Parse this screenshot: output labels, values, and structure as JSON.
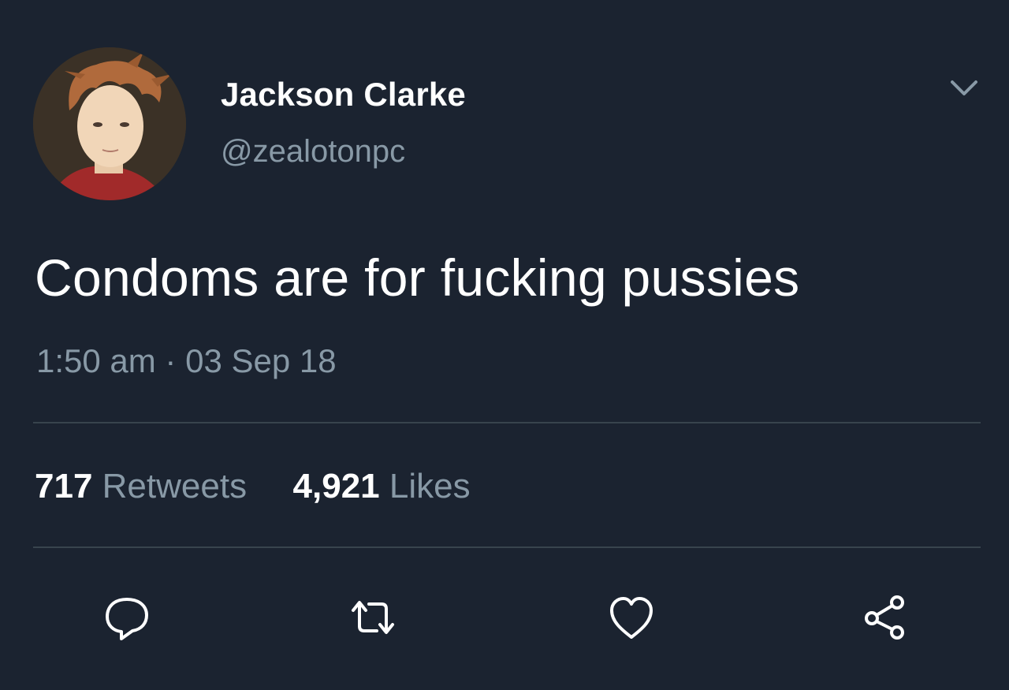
{
  "user": {
    "display_name": "Jackson Clarke",
    "handle": "@zealotonpc",
    "avatar_icon": "avatar-illustration"
  },
  "tweet": {
    "text": "Condoms are for fucking pussies",
    "timestamp": "1:50 am · 03 Sep 18"
  },
  "stats": {
    "retweets_count": "717",
    "retweets_label": "Retweets",
    "likes_count": "4,921",
    "likes_label": "Likes"
  },
  "actions": [
    {
      "name": "reply",
      "icon": "reply-icon"
    },
    {
      "name": "retweet",
      "icon": "retweet-icon"
    },
    {
      "name": "like",
      "icon": "heart-icon"
    },
    {
      "name": "share",
      "icon": "share-icon"
    }
  ],
  "colors": {
    "background": "#1b2330",
    "primary_text": "#ffffff",
    "secondary_text": "#8899a6",
    "divider": "#38444d"
  }
}
